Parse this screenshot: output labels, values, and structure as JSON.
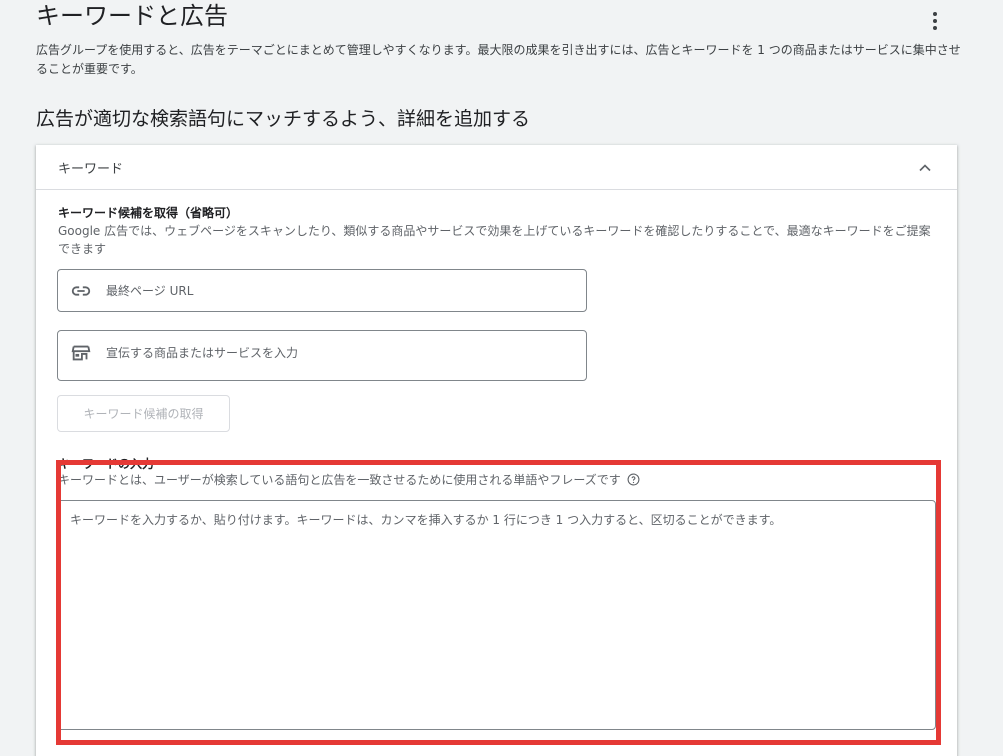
{
  "page": {
    "title": "キーワードと広告",
    "description": "広告グループを使用すると、広告をテーマごとにまとめて管理しやすくなります。最大限の成果を引き出すには、広告とキーワードを 1 つの商品またはサービスに集中させることが重要です。",
    "section_heading": "広告が適切な検索語句にマッチするよう、詳細を追加する"
  },
  "keywords_card": {
    "header": "キーワード",
    "suggestions": {
      "title": "キーワード候補を取得（省略可）",
      "description": "Google 広告では、ウェブページをスキャンしたり、類似する商品やサービスで効果を上げているキーワードを確認したりすることで、最適なキーワードをご提案できます",
      "url_placeholder": "最終ページ URL",
      "product_placeholder": "宣伝する商品またはサービスを入力",
      "button_label": "キーワード候補の取得"
    },
    "keyword_input": {
      "label": "キーワードの入力",
      "description": "キーワードとは、ユーザーが検索している語句と広告を一致させるために使用される単語やフレーズです",
      "placeholder": "キーワードを入力するか、貼り付けます。キーワードは、カンマを挿入するか 1 行につき 1 つ入力すると、区切ることができます。"
    }
  },
  "icons": {
    "more": "more-vert-icon",
    "collapse": "chevron-up-icon",
    "url": "link-icon",
    "product": "store-icon",
    "help": "help-circle-icon"
  },
  "colors": {
    "highlight": "#e53935",
    "background": "#f1f3f4",
    "card": "#ffffff"
  }
}
